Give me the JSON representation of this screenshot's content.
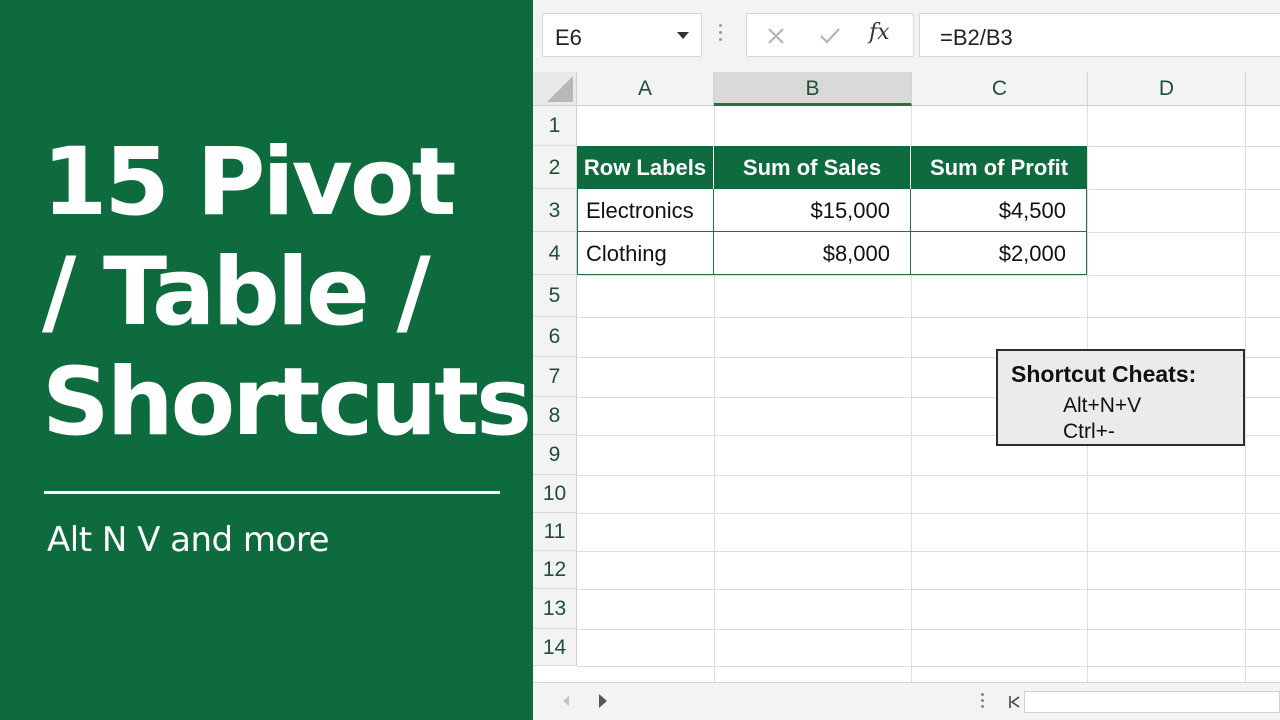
{
  "promo": {
    "title_line1": "15 Pivot",
    "title_line2": "/ Table /",
    "title_line3": "Shortcuts",
    "subtitle": "Alt N V and more",
    "background_color": "#0e6b3e"
  },
  "formula_bar": {
    "name_box": "E6",
    "cancel_icon": "x-icon",
    "enter_icon": "check-icon",
    "function_label": "fx",
    "formula": "=B2/B3"
  },
  "columns": [
    "A",
    "B",
    "C",
    "D"
  ],
  "selected_column": "B",
  "rows": [
    "1",
    "2",
    "3",
    "4",
    "5",
    "6",
    "7",
    "8",
    "9",
    "10",
    "11",
    "12",
    "13",
    "14"
  ],
  "pivot": {
    "headers": [
      "Row Labels",
      "Sum of Sales",
      "Sum of Profit"
    ],
    "rows": [
      {
        "label": "Electronics",
        "sales": "$15,000",
        "profit": "$4,500"
      },
      {
        "label": "Clothing",
        "sales": "$8,000",
        "profit": "$2,000"
      }
    ],
    "header_color": "#0e6b3e",
    "border_color": "#217346"
  },
  "shortcut_box": {
    "title": "Shortcut Cheats:",
    "lines": [
      "Alt+N+V",
      "Ctrl+-"
    ]
  },
  "bottom_bar": {
    "prev_icon": "chevron-left-icon",
    "next_icon": "chevron-right-icon"
  }
}
